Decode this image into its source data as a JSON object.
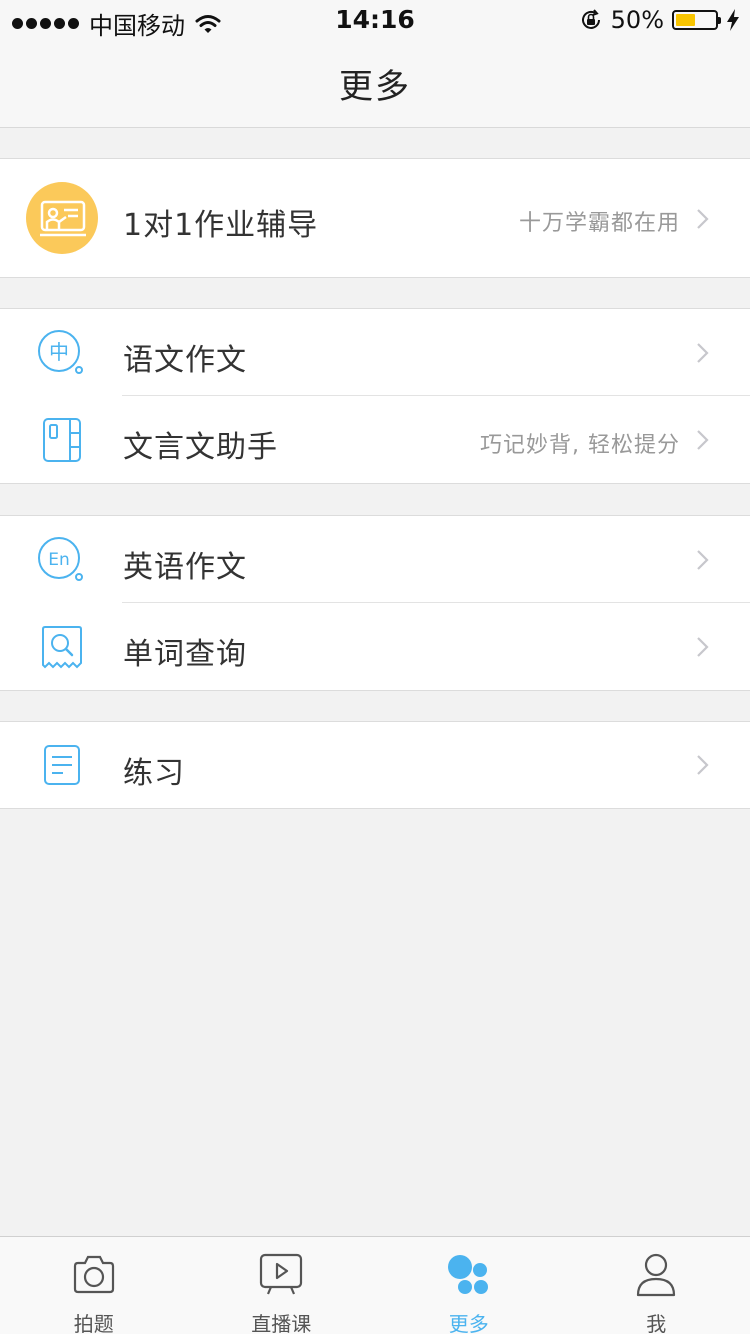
{
  "status_bar": {
    "carrier": "中国移动",
    "time": "14:16",
    "battery_percent_text": "50%",
    "battery_level": 0.5
  },
  "nav": {
    "title": "更多"
  },
  "groups": [
    {
      "items": [
        {
          "label": "1对1作业辅导",
          "subtitle": "十万学霸都在用",
          "icon": "tutor-board-icon"
        }
      ]
    },
    {
      "items": [
        {
          "label": "语文作文",
          "subtitle": "",
          "icon": "chinese-essay-icon"
        },
        {
          "label": "文言文助手",
          "subtitle": "巧记妙背, 轻松提分",
          "icon": "classical-chinese-book-icon"
        }
      ]
    },
    {
      "items": [
        {
          "label": "英语作文",
          "subtitle": "",
          "icon": "english-essay-icon"
        },
        {
          "label": "单词查询",
          "subtitle": "",
          "icon": "word-search-icon"
        }
      ]
    },
    {
      "items": [
        {
          "label": "练习",
          "subtitle": "",
          "icon": "practice-document-icon"
        }
      ]
    }
  ],
  "tab_bar": {
    "tabs": [
      {
        "label": "拍题",
        "icon": "camera-icon",
        "active": false
      },
      {
        "label": "直播课",
        "icon": "live-class-icon",
        "active": false
      },
      {
        "label": "更多",
        "icon": "more-dots-icon",
        "active": true
      },
      {
        "label": "我",
        "icon": "profile-icon",
        "active": false
      }
    ]
  },
  "colors": {
    "accent": "#4bb3ef",
    "tutor_icon_bg": "#fbc95a",
    "battery_fill": "#f7c400",
    "background": "#f2f2f2"
  },
  "icon_glyphs": {
    "chinese_essay": "中",
    "english_essay": "En"
  }
}
